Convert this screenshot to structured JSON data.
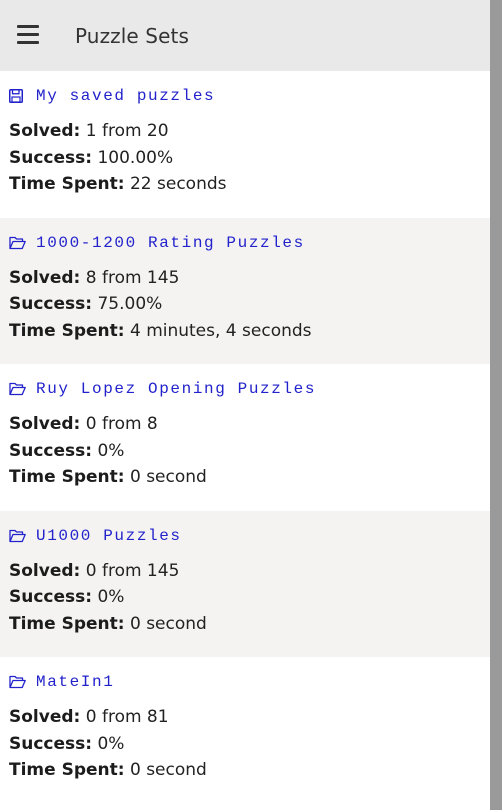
{
  "header": {
    "title": "Puzzle Sets",
    "menu_icon": "hamburger-menu-icon"
  },
  "labels": {
    "solved": "Solved:",
    "success": "Success:",
    "time_spent": "Time Spent:"
  },
  "colors": {
    "link": "#2222cc",
    "header_bg": "#e9e9e9",
    "alt_row_bg": "#f4f3f2",
    "scrollbar": "#9a9a9a"
  },
  "sets": [
    {
      "icon": "floppy-disk-icon",
      "name": "My saved puzzles",
      "solved": "1 from 20",
      "success": "100.00%",
      "time_spent": "22 seconds"
    },
    {
      "icon": "folder-open-icon",
      "name": "1000-1200 Rating Puzzles",
      "solved": "8 from 145",
      "success": "75.00%",
      "time_spent": "4 minutes, 4 seconds"
    },
    {
      "icon": "folder-open-icon",
      "name": "Ruy Lopez Opening Puzzles",
      "solved": "0 from 8",
      "success": "0%",
      "time_spent": "0 second"
    },
    {
      "icon": "folder-open-icon",
      "name": "U1000 Puzzles",
      "solved": "0 from 145",
      "success": "0%",
      "time_spent": "0 second"
    },
    {
      "icon": "folder-open-icon",
      "name": "MateIn1",
      "solved": "0 from 81",
      "success": "0%",
      "time_spent": "0 second"
    }
  ]
}
